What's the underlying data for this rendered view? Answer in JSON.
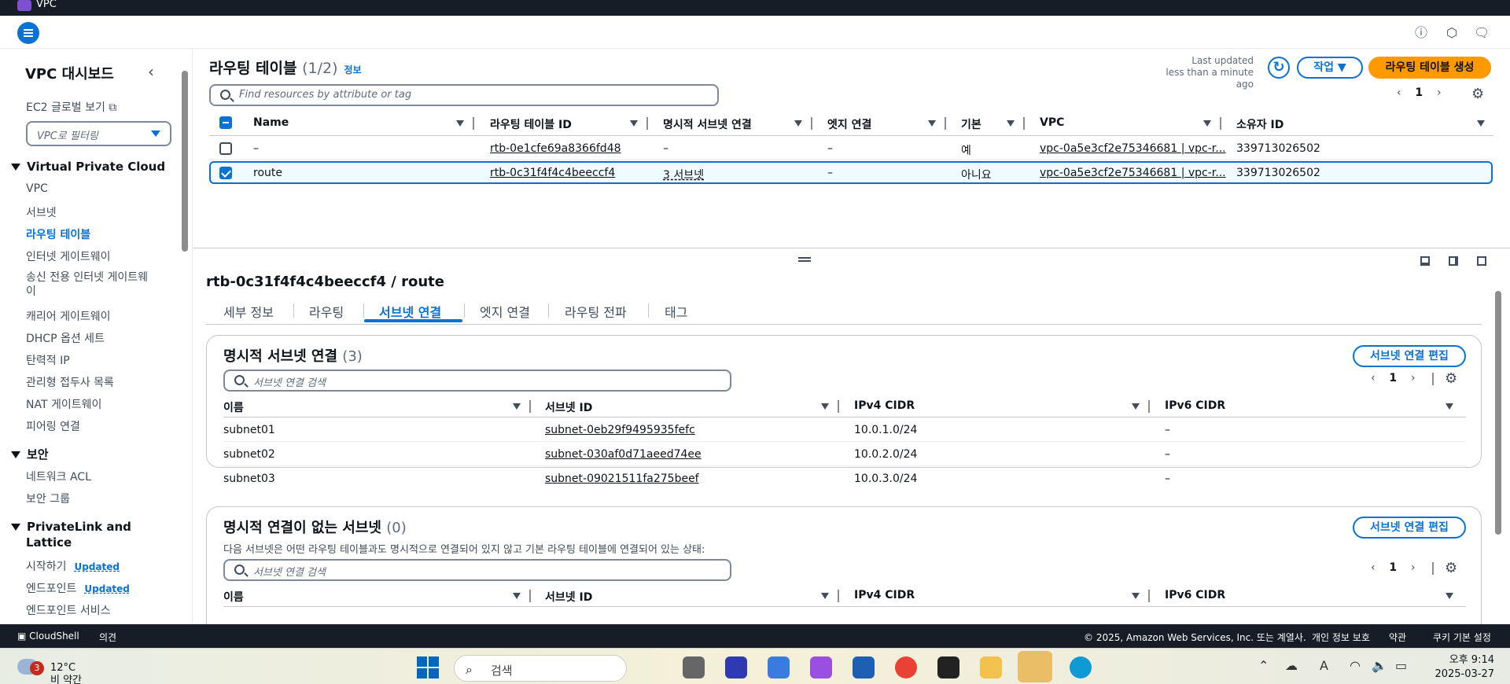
{
  "app": {
    "title": "VPC"
  },
  "sidebar": {
    "title": "VPC 대시보드",
    "ec2_link": "EC2 글로벌 보기",
    "filter_placeholder": "VPC로 필터링",
    "sections": [
      {
        "title": "Virtual Private Cloud",
        "items": [
          "VPC",
          "서브넷",
          "라우팅 테이블",
          "인터넷 게이트웨이",
          "송신 전용 인터넷 게이트웨이",
          "캐리어 게이트웨이",
          "DHCP 옵션 세트",
          "탄력적 IP",
          "관리형 접두사 목록",
          "NAT 게이트웨이",
          "피어링 연결"
        ]
      },
      {
        "title": "보안",
        "items": [
          "네트워크 ACL",
          "보안 그룹"
        ]
      },
      {
        "title": "PrivateLink and Lattice",
        "items": [
          "시작하기",
          "엔드포인트",
          "엔드포인트 서비스"
        ]
      }
    ],
    "updated_label": "Updated",
    "ptl_line1": "PrivateLink and",
    "ptl_line2": "Lattice",
    "egress_line1": "송신 전용 인터넷 게이트웨",
    "egress_line2": "이"
  },
  "route_tables": {
    "title": "라우팅 테이블",
    "count": "(1/2)",
    "info": "정보",
    "last_updated": "Last updated",
    "last_updated_when": "less than a minute ago",
    "actions_label": "작업",
    "create_label": "라우팅 테이블 생성",
    "search_placeholder": "Find resources by attribute or tag",
    "page": "1",
    "columns": [
      "Name",
      "라우팅 테이블 ID",
      "명시적 서브넷 연결",
      "엣지 연결",
      "기본",
      "VPC",
      "소유자 ID"
    ],
    "rows": [
      {
        "name": "–",
        "id": "rtb-0e1cfe69a8366fd48",
        "subnets": "–",
        "edge": "–",
        "main": "예",
        "vpc": "vpc-0a5e3cf2e75346681 | vpc-r...",
        "owner": "339713026502",
        "selected": false
      },
      {
        "name": "route",
        "id": "rtb-0c31f4f4c4beeccf4",
        "subnets": "3 서브넷",
        "edge": "–",
        "main": "아니요",
        "vpc": "vpc-0a5e3cf2e75346681 | vpc-r...",
        "owner": "339713026502",
        "selected": true
      }
    ]
  },
  "detail": {
    "title": "rtb-0c31f4f4c4beeccf4 / route",
    "tabs": [
      "세부 정보",
      "라우팅",
      "서브넷 연결",
      "엣지 연결",
      "라우팅 전파",
      "태그"
    ],
    "active_tab": "서브넷 연결",
    "explicit": {
      "title": "명시적 서브넷 연결",
      "count": "(3)",
      "edit_label": "서브넷 연결 편집",
      "search_placeholder": "서브넷 연결 검색",
      "page": "1",
      "columns": [
        "이름",
        "서브넷 ID",
        "IPv4 CIDR",
        "IPv6 CIDR"
      ],
      "rows": [
        {
          "name": "subnet01",
          "id": "subnet-0eb29f9495935fefc",
          "ipv4": "10.0.1.0/24",
          "ipv6": "–"
        },
        {
          "name": "subnet02",
          "id": "subnet-030af0d71aeed74ee",
          "ipv4": "10.0.2.0/24",
          "ipv6": "–"
        },
        {
          "name": "subnet03",
          "id": "subnet-09021511fa275beef",
          "ipv4": "10.0.3.0/24",
          "ipv6": "–"
        }
      ]
    },
    "unassoc": {
      "title": "명시적 연결이 없는 서브넷",
      "count": "(0)",
      "edit_label": "서브넷 연결 편집",
      "desc": "다음 서브넷은 어떤 라우팅 테이블과도 명시적으로 연결되어 있지 않고 기본 라우팅 테이블에 연결되어 있는 상태:",
      "search_placeholder": "서브넷 연결 검색",
      "page": "1",
      "columns": [
        "이름",
        "서브넷 ID",
        "IPv4 CIDR",
        "IPv6 CIDR"
      ]
    }
  },
  "footer": {
    "cloudshell": "CloudShell",
    "feedback": "의견",
    "copyright": "© 2025, Amazon Web Services, Inc. 또는 계열사.",
    "privacy": "개인 정보 보호",
    "terms": "약관",
    "cookies": "쿠키 기본 설정"
  },
  "taskbar": {
    "weather_temp": "12°C",
    "weather_desc": "비 약간",
    "weather_badge": "3",
    "search_label": "검색",
    "time": "오후 9:14",
    "date": "2025-03-27"
  }
}
